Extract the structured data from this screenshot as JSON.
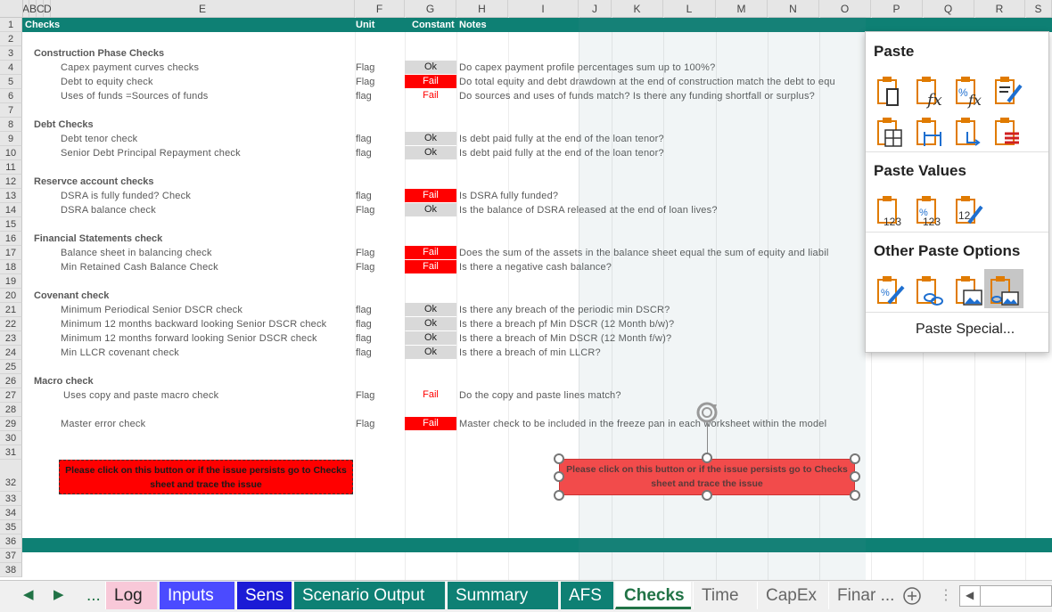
{
  "columns": [
    "A",
    "B",
    "C",
    "D",
    "E",
    "F",
    "G",
    "H",
    "I",
    "J",
    "K",
    "L",
    "M",
    "N",
    "O",
    "P",
    "Q",
    "R",
    "S"
  ],
  "rows": [
    "1",
    "2",
    "3",
    "4",
    "5",
    "6",
    "7",
    "8",
    "9",
    "10",
    "11",
    "12",
    "13",
    "14",
    "15",
    "16",
    "17",
    "18",
    "19",
    "20",
    "21",
    "22",
    "23",
    "24",
    "25",
    "26",
    "27",
    "28",
    "29",
    "30",
    "31",
    "32",
    "33",
    "34",
    "35",
    "36",
    "37",
    "38"
  ],
  "header": {
    "checks": "Checks",
    "unit": "Unit",
    "constant": "Constant",
    "notes": "Notes"
  },
  "sections": [
    {
      "row": 3,
      "title": "Construction Phase Checks"
    },
    {
      "row": 8,
      "title": "Debt Checks"
    },
    {
      "row": 12,
      "title": "Reservce account checks"
    },
    {
      "row": 16,
      "title": "Financial Statements check"
    },
    {
      "row": 20,
      "title": "Covenant check"
    },
    {
      "row": 26,
      "title": "Macro check"
    }
  ],
  "checks": [
    {
      "row": 4,
      "label": "Capex payment curves checks",
      "unit": "Flag",
      "value": "Ok",
      "style": "ok",
      "note": "Do capex payment profile percentages sum up to 100%?"
    },
    {
      "row": 5,
      "label": "Debt to equity check",
      "unit": "Flag",
      "value": "Fail",
      "style": "fail",
      "note": "Do total equity and debt drawdown at the end of construction match the debt to equ"
    },
    {
      "row": 6,
      "label": "Uses of funds =Sources of funds",
      "unit": "flag",
      "value": "Fail",
      "style": "failtxt",
      "note": "Do sources and uses of funds match? Is there any funding shortfall or surplus?"
    },
    {
      "row": 9,
      "label": "Debt tenor check",
      "unit": "flag",
      "value": "Ok",
      "style": "ok",
      "note": "Is debt paid fully at the end of the loan tenor?"
    },
    {
      "row": 10,
      "label": "Senior Debt  Principal Repayment  check",
      "unit": "flag",
      "value": "Ok",
      "style": "ok",
      "note": "Is debt paid fully at the end of the loan tenor?"
    },
    {
      "row": 13,
      "label": "DSRA is fully funded? Check",
      "unit": "flag",
      "value": "Fail",
      "style": "fail",
      "note": "Is DSRA fully funded?"
    },
    {
      "row": 14,
      "label": "DSRA balance check",
      "unit": "Flag",
      "value": "Ok",
      "style": "ok",
      "note": "Is the balance of DSRA released at the end of loan lives?"
    },
    {
      "row": 17,
      "label": "Balance sheet in balancing check",
      "unit": "Flag",
      "value": "Fail",
      "style": "fail",
      "note": "Does the sum of the assets in the balance sheet equal the sum of equity and liabil"
    },
    {
      "row": 18,
      "label": "Min Retained Cash Balance Check",
      "unit": "Flag",
      "value": "Fail",
      "style": "fail",
      "note": "Is there a negative cash balance?"
    },
    {
      "row": 21,
      "label": "Minimum  Periodical Senior DSCR check",
      "unit": "flag",
      "value": "Ok",
      "style": "ok",
      "note": "Is there any breach of the periodic min DSCR?"
    },
    {
      "row": 22,
      "label": "Minimum  12 months backward looking Senior DSCR check",
      "unit": "flag",
      "value": "Ok",
      "style": "ok",
      "note": "Is there a breach pf Min DSCR (12 Month b/w)?"
    },
    {
      "row": 23,
      "label": "Minimum  12 months forward looking Senior DSCR check",
      "unit": "flag",
      "value": "Ok",
      "style": "ok",
      "note": "Is there a breach of Min DSCR (12 Month f/w)?"
    },
    {
      "row": 24,
      "label": "Min LLCR covenant check",
      "unit": "flag",
      "value": "Ok",
      "style": "ok",
      "note": "Is there a breach of min LLCR?"
    },
    {
      "row": 27,
      "label": "Uses copy and paste macro check",
      "unit": "Flag",
      "value": "Fail",
      "style": "failtxt",
      "note": "Do the copy and paste lines match?"
    },
    {
      "row": 29,
      "label": "Master error check",
      "unit": "Flag",
      "value": "Fail",
      "style": "fail",
      "note": "Master check to be included in the freeze pan in each worksheet within the model"
    }
  ],
  "button_text": "Please click on this button or if the issue persists go to Checks sheet and trace the issue",
  "paste_menu": {
    "paste": "Paste",
    "paste_values": "Paste Values",
    "other": "Other Paste Options",
    "special": "Paste Special..."
  },
  "tabs": [
    {
      "label": "...",
      "color": "#f0f0f0",
      "text": "#217346"
    },
    {
      "label": "Log",
      "color": "#f8c8d8",
      "text": "#222"
    },
    {
      "label": "Inputs",
      "color": "#4b4bff",
      "text": "#fff"
    },
    {
      "label": "Sens",
      "color": "#1b1bd6",
      "text": "#fff"
    },
    {
      "label": "Scenario Output",
      "color": "#0e8074",
      "text": "#fff"
    },
    {
      "label": "Summary",
      "color": "#0e8074",
      "text": "#fff"
    },
    {
      "label": "AFS",
      "color": "#0e8074",
      "text": "#fff"
    },
    {
      "label": "Checks",
      "color": "#ffffff",
      "text": "#217346",
      "active": true
    },
    {
      "label": "Time",
      "color": "#f0f0f0",
      "text": "#666"
    },
    {
      "label": "CapEx",
      "color": "#f0f0f0",
      "text": "#666"
    },
    {
      "label": "Finar ...",
      "color": "#f0f0f0",
      "text": "#666"
    }
  ],
  "colors": {
    "teal": "#0e8074",
    "fail": "#ff0000",
    "ok": "#d9d9d9"
  }
}
